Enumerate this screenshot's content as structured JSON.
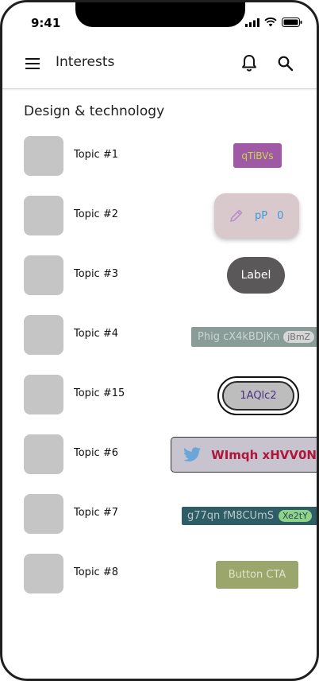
{
  "status_bar": {
    "time": "9:41"
  },
  "app_bar": {
    "title": "Interests"
  },
  "section": {
    "title": "Design & technology"
  },
  "topics": [
    {
      "label": "Topic #1",
      "chip": {
        "text": "qTiBVs"
      }
    },
    {
      "label": "Topic #2",
      "chip": {
        "text": "pP",
        "count": "0"
      }
    },
    {
      "label": "Topic #3",
      "chip": {
        "text": "Label"
      }
    },
    {
      "label": "Topic #4",
      "chip": {
        "text": "Phig cX4kBDjKn",
        "badge": "jBmZ"
      }
    },
    {
      "label": "Topic #15",
      "chip": {
        "text": "1AQlc2"
      }
    },
    {
      "label": "Topic #6",
      "chip": {
        "text": "WImqh xHVV0N"
      }
    },
    {
      "label": "Topic #7",
      "chip": {
        "text": "g77qn fM8CUmS",
        "badge": "Xe2tY"
      }
    },
    {
      "label": "Topic #8",
      "chip": {
        "text": "Button CTA"
      }
    }
  ],
  "colors": {
    "chip1_bg": "#a05aa5",
    "chip1_fg": "#c7d64a",
    "chip2_bg": "#d9c9cc",
    "chip2_fg": "#3a9ad8",
    "chip3_bg": "#5a5858",
    "chip4_bg": "#8a9c98",
    "chip5_bg": "#bdbdbd",
    "chip5_fg": "#4a2f8a",
    "chip6_bg": "#c7c4d0",
    "chip6_fg": "#b0153a",
    "twitter": "#6aa7d8",
    "chip7_bg": "#2f5d66",
    "chip7_badge": "#8fd38a",
    "chip8_bg": "#9ba66c"
  },
  "icons": [
    "menu-icon",
    "bell-icon",
    "search-icon",
    "pencil-icon",
    "twitter-icon"
  ]
}
